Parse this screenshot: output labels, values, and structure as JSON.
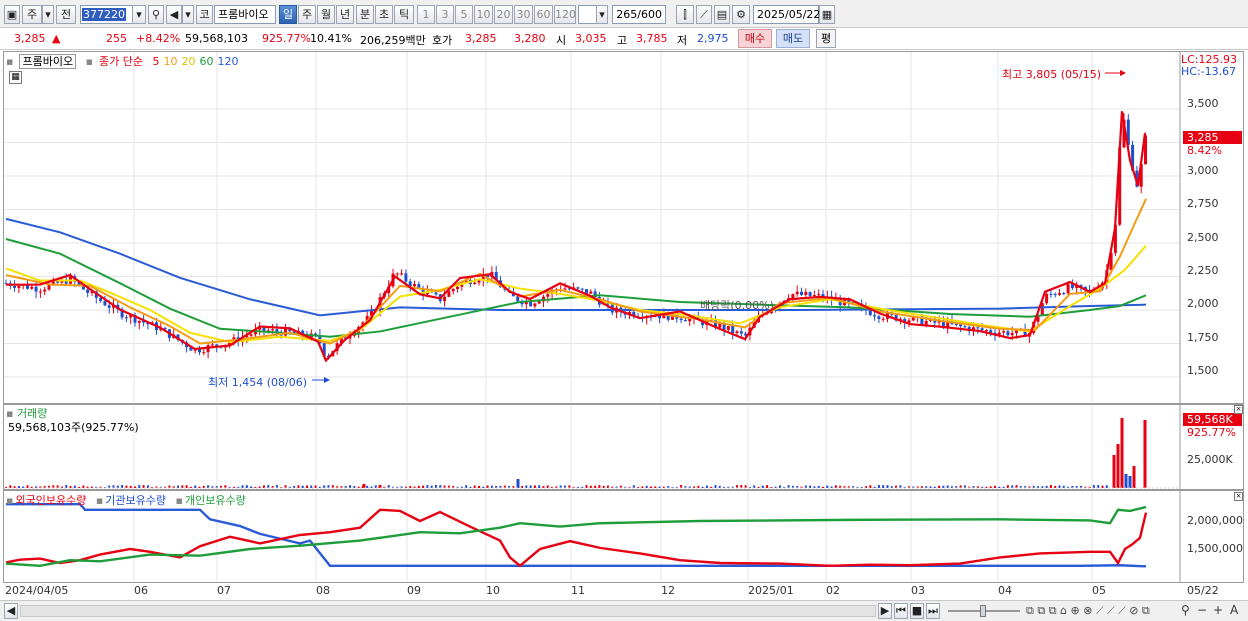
{
  "toolbar": {
    "market_sel": "주",
    "price_type": "전",
    "code": "377220",
    "search_icon": "magnifier-icon",
    "speaker_icon": "speaker-icon",
    "kospi_tag": "코",
    "stock_name": "프롬바이오",
    "periods": [
      "일",
      "주",
      "월",
      "년",
      "분",
      "초",
      "틱"
    ],
    "active_period": "일",
    "intervals": [
      "1",
      "3",
      "5",
      "10",
      "20",
      "30",
      "60",
      "120"
    ],
    "count": "265",
    "count_max": "/600",
    "date": "2025/05/22"
  },
  "quote": {
    "price": "3,285",
    "change": "255",
    "change_pct": "+8.42%",
    "volume": "59,568,103",
    "vol_ratio": "925.77%",
    "turnover": "10.41%",
    "amount": "206,259백만",
    "bid_label": "호가",
    "bid1": "3,285",
    "bid2": "3,280",
    "open_label": "시",
    "open": "3,035",
    "high_label": "고",
    "high": "3,785",
    "low_label": "저",
    "low": "2,975",
    "buy": "매수",
    "sell": "매도",
    "avg": "평"
  },
  "price_panel": {
    "name": "프롬바이오",
    "ma_title": "종가 단순",
    "ma_periods": [
      "5",
      "10",
      "20",
      "60",
      "120"
    ],
    "lc_label": "LC:125.93",
    "hc_label": "HC:-13.67",
    "high_note": "최고 3,805 (05/15)",
    "low_note": "최저 1,454 (08/06)",
    "dividend_note": "배당락(0.00%)",
    "y_ticks": [
      "3,500",
      "3,250",
      "3,000",
      "2,750",
      "2,500",
      "2,250",
      "2,000",
      "1,750",
      "1,500"
    ],
    "current_tag": "3,285",
    "current_pct": "8.42%"
  },
  "volume_panel": {
    "title": "거래량",
    "value": "59,568,103주(925.77%)",
    "tag": "59,568K",
    "tag_pct": "925.77%",
    "y_tick": "25,000K"
  },
  "holdings_panel": {
    "legend": [
      "외국인보유수량",
      "기관보유수량",
      "개인보유수량"
    ],
    "y_ticks": [
      "2,000,000",
      "1,500,000"
    ]
  },
  "x_labels": [
    "2024/04/05",
    "06",
    "07",
    "08",
    "09",
    "10",
    "11",
    "12",
    "2025/01",
    "02",
    "03",
    "04",
    "05",
    "05/22"
  ],
  "colors": {
    "up": "#e60012",
    "down": "#1f4fd0",
    "ma5": "#e60012",
    "ma10": "#f39c12",
    "ma20": "#f5e000",
    "ma60": "#1e9e3a",
    "ma120": "#2a5bd7"
  }
}
